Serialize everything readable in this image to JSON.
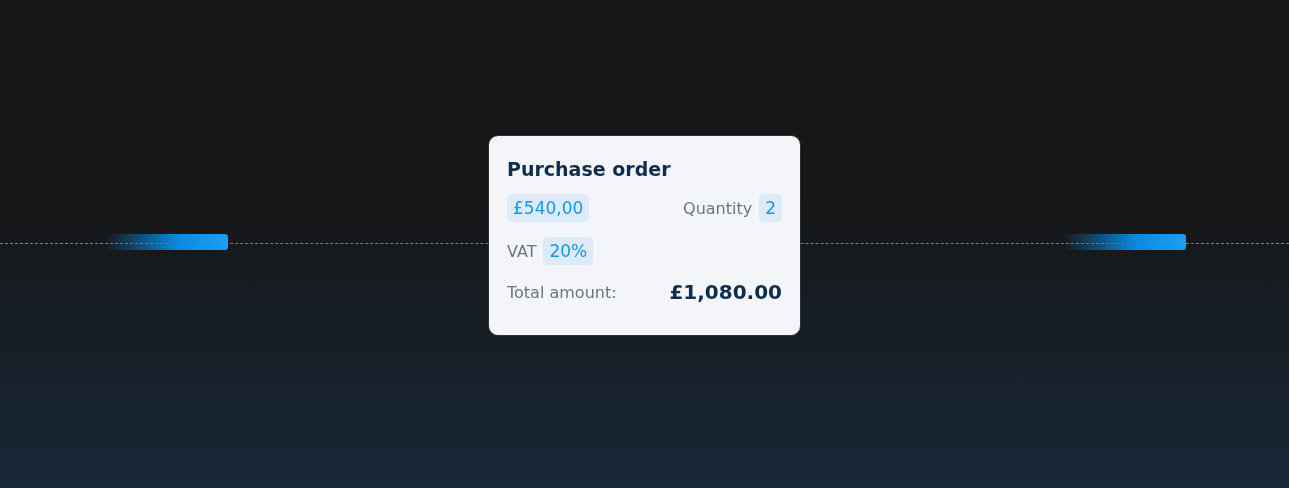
{
  "card": {
    "title": "Purchase order",
    "price": "£540,00",
    "quantity_label": "Quantity",
    "quantity": "2",
    "vat_label": "VAT",
    "vat": "20%",
    "total_label": "Total amount:",
    "total": "£1,080.00"
  }
}
